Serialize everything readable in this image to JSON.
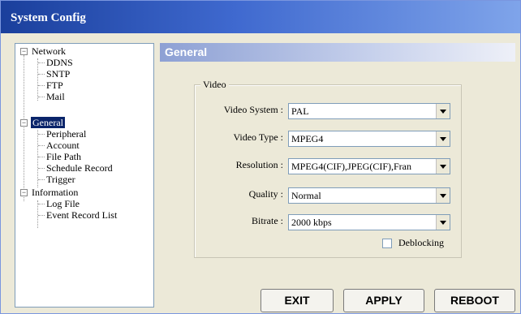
{
  "window": {
    "title": "System Config"
  },
  "tree": {
    "items": [
      {
        "label": "Network",
        "level": 0,
        "expanded": true
      },
      {
        "label": "DDNS",
        "level": 1
      },
      {
        "label": "SNTP",
        "level": 1
      },
      {
        "label": "FTP",
        "level": 1
      },
      {
        "label": "Mail",
        "level": 1
      },
      {
        "label": "General",
        "level": 0,
        "expanded": true,
        "selected": true
      },
      {
        "label": "Peripheral",
        "level": 1
      },
      {
        "label": "Account",
        "level": 1
      },
      {
        "label": "File Path",
        "level": 1
      },
      {
        "label": "Schedule Record",
        "level": 1
      },
      {
        "label": "Trigger",
        "level": 1
      },
      {
        "label": "Information",
        "level": 0,
        "expanded": true
      },
      {
        "label": "Log File",
        "level": 1
      },
      {
        "label": "Event Record List",
        "level": 1
      }
    ]
  },
  "section": {
    "title": "General"
  },
  "video": {
    "group_label": "Video",
    "system_label": "Video System :",
    "system_value": "PAL",
    "type_label": "Video Type :",
    "type_value": "MPEG4",
    "resolution_label": "Resolution :",
    "resolution_value": "MPEG4(CIF),JPEG(CIF),Fran",
    "quality_label": "Quality :",
    "quality_value": "Normal",
    "bitrate_label": "Bitrate :",
    "bitrate_value": "2000 kbps",
    "deblocking_label": "Deblocking",
    "deblocking_checked": false
  },
  "buttons": {
    "exit": "EXIT",
    "apply": "APPLY",
    "reboot": "REBOOT"
  },
  "colors": {
    "selection": "#0a246a",
    "background": "#ece9d8"
  }
}
